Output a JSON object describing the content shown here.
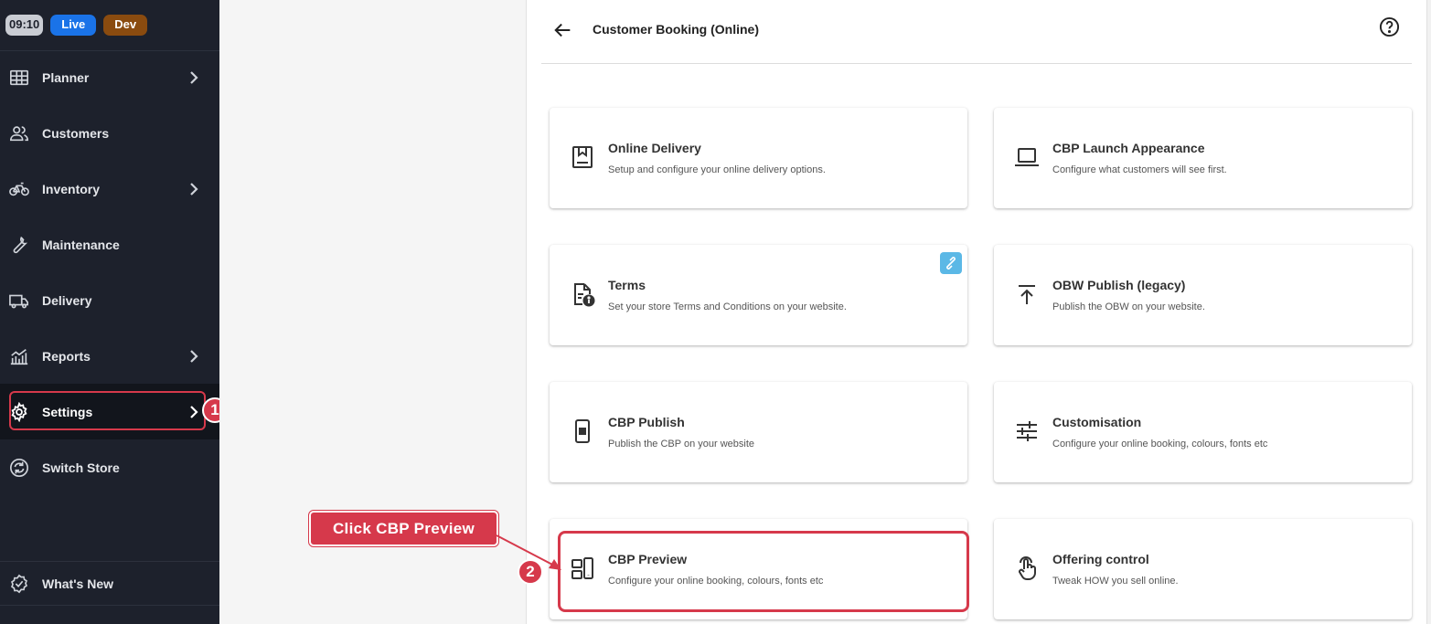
{
  "topbar": {
    "time": "09:10",
    "env_live": "Live",
    "env_dev": "Dev"
  },
  "sidebar": {
    "items": [
      {
        "label": "Planner",
        "icon": "grid-icon",
        "chevron": true
      },
      {
        "label": "Customers",
        "icon": "people-icon",
        "chevron": false
      },
      {
        "label": "Inventory",
        "icon": "bike-icon",
        "chevron": true
      },
      {
        "label": "Maintenance",
        "icon": "wrench-icon",
        "chevron": false
      },
      {
        "label": "Delivery",
        "icon": "truck-icon",
        "chevron": false
      },
      {
        "label": "Reports",
        "icon": "chart-icon",
        "chevron": true
      },
      {
        "label": "Settings",
        "icon": "gear-icon",
        "chevron": true,
        "active": true
      },
      {
        "label": "Switch Store",
        "icon": "sync-icon",
        "chevron": false
      }
    ],
    "whats_new": "What's New"
  },
  "header": {
    "title": "Customer Booking (Online)"
  },
  "cards": [
    {
      "title": "Online Delivery",
      "desc": "Setup and configure your online delivery options.",
      "icon": "package-icon"
    },
    {
      "title": "CBP Launch Appearance",
      "desc": "Configure what customers will see first.",
      "icon": "laptop-icon"
    },
    {
      "title": "Terms",
      "desc": "Set your store Terms and Conditions on your website.",
      "icon": "document-info-icon"
    },
    {
      "title": "OBW Publish (legacy)",
      "desc": "Publish the OBW on your website.",
      "icon": "upload-icon"
    },
    {
      "title": "CBP Publish",
      "desc": "Publish the CBP on your website",
      "icon": "mobile-icon"
    },
    {
      "title": "Customisation",
      "desc": "Configure your online booking, colours, fonts etc",
      "icon": "sliders-icon"
    },
    {
      "title": "CBP Preview",
      "desc": "Configure your online booking, colours, fonts etc",
      "icon": "devices-icon"
    },
    {
      "title": "Offering control",
      "desc": "Tweak HOW you sell online.",
      "icon": "tap-icon"
    }
  ],
  "annotations": {
    "step1": "1",
    "step2": "2",
    "callout": "Click CBP Preview"
  },
  "colors": {
    "sidebar_bg": "#1d212c",
    "highlight": "#d6394b",
    "live": "#1a73e8",
    "dev": "#8a4b0f"
  }
}
